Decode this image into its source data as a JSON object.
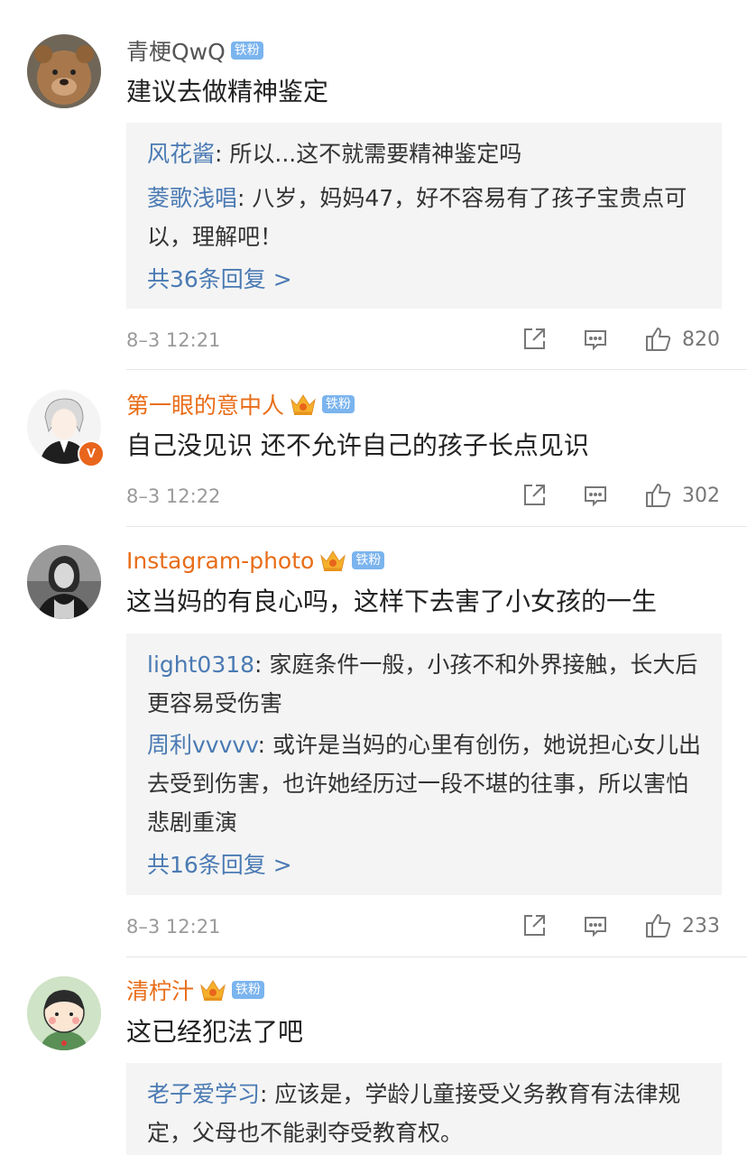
{
  "comments": [
    {
      "name": "青梗QwQ",
      "fan_badge": "铁粉",
      "text": "建议去做精神鉴定",
      "replies": [
        {
          "user": "风花酱",
          "sep": ": ",
          "text": "所以...这不就需要精神鉴定吗"
        },
        {
          "user": "菱歌浅唱",
          "sep": ": ",
          "text": "八岁，妈妈47，好不容易有了孩子宝贵点可以，理解吧！"
        }
      ],
      "more": "共36条回复 >",
      "time": "8–3 12:21",
      "likes": "820"
    },
    {
      "name": "第一眼的意中人",
      "fan_badge": "铁粉",
      "verified_badge": "V",
      "text": "自己没见识 还不允许自己的孩子长点见识",
      "time": "8–3 12:22",
      "likes": "302"
    },
    {
      "name": "Instagram-photo",
      "fan_badge": "铁粉",
      "text": "这当妈的有良心吗，这样下去害了小女孩的一生",
      "replies": [
        {
          "user": "light0318",
          "sep": ": ",
          "text": "家庭条件一般，小孩不和外界接触，长大后更容易受伤害"
        },
        {
          "user": "周利vvvvv",
          "sep": ": ",
          "text": "或许是当妈的心里有创伤，她说担心女儿出去受到伤害，也许她经历过一段不堪的往事，所以害怕悲剧重演"
        }
      ],
      "more": "共16条回复 >",
      "time": "8–3 12:21",
      "likes": "233"
    },
    {
      "name": "清柠汁",
      "fan_badge": "铁粉",
      "text": "这已经犯法了吧",
      "replies": [
        {
          "user": "老子爱学习",
          "sep": ": ",
          "text": "应该是，学龄儿童接受义务教育有法律规定，父母也不能剥夺受教育权。"
        }
      ]
    }
  ],
  "colors": {
    "username_orange": "#e86d18",
    "reply_user_blue": "#4a7ab3",
    "fan_badge_blue": "#7bb4ee",
    "reply_bg": "#f4f4f4",
    "time_gray": "#9a9a9a"
  },
  "icons": {
    "share": "share-icon",
    "comment": "comment-icon",
    "like": "thumbs-up-icon",
    "crown": "crown-icon"
  }
}
